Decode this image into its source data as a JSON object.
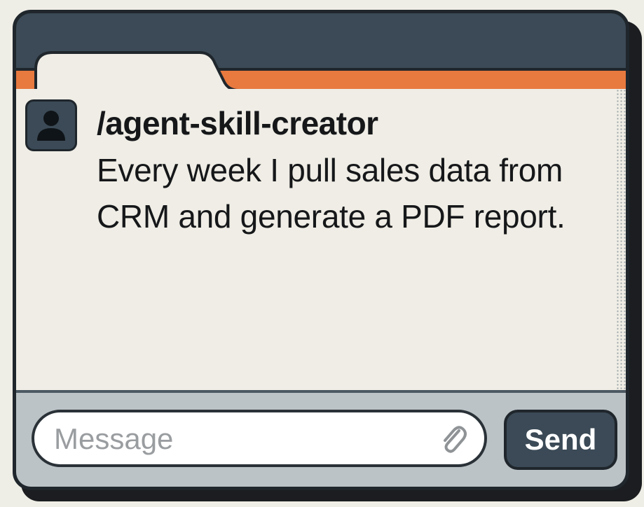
{
  "chat": {
    "command": "/agent-skill-creator",
    "message": "Every week I pull sales data from CRM and generate a PDF report."
  },
  "composer": {
    "placeholder": "Message",
    "send_label": "Send",
    "attach_icon": "paperclip-icon"
  },
  "colors": {
    "accent_stripe": "#e8793f",
    "window_frame": "#3b4a56",
    "content_bg": "#efede5",
    "composer_bg": "#bcc3c6"
  }
}
